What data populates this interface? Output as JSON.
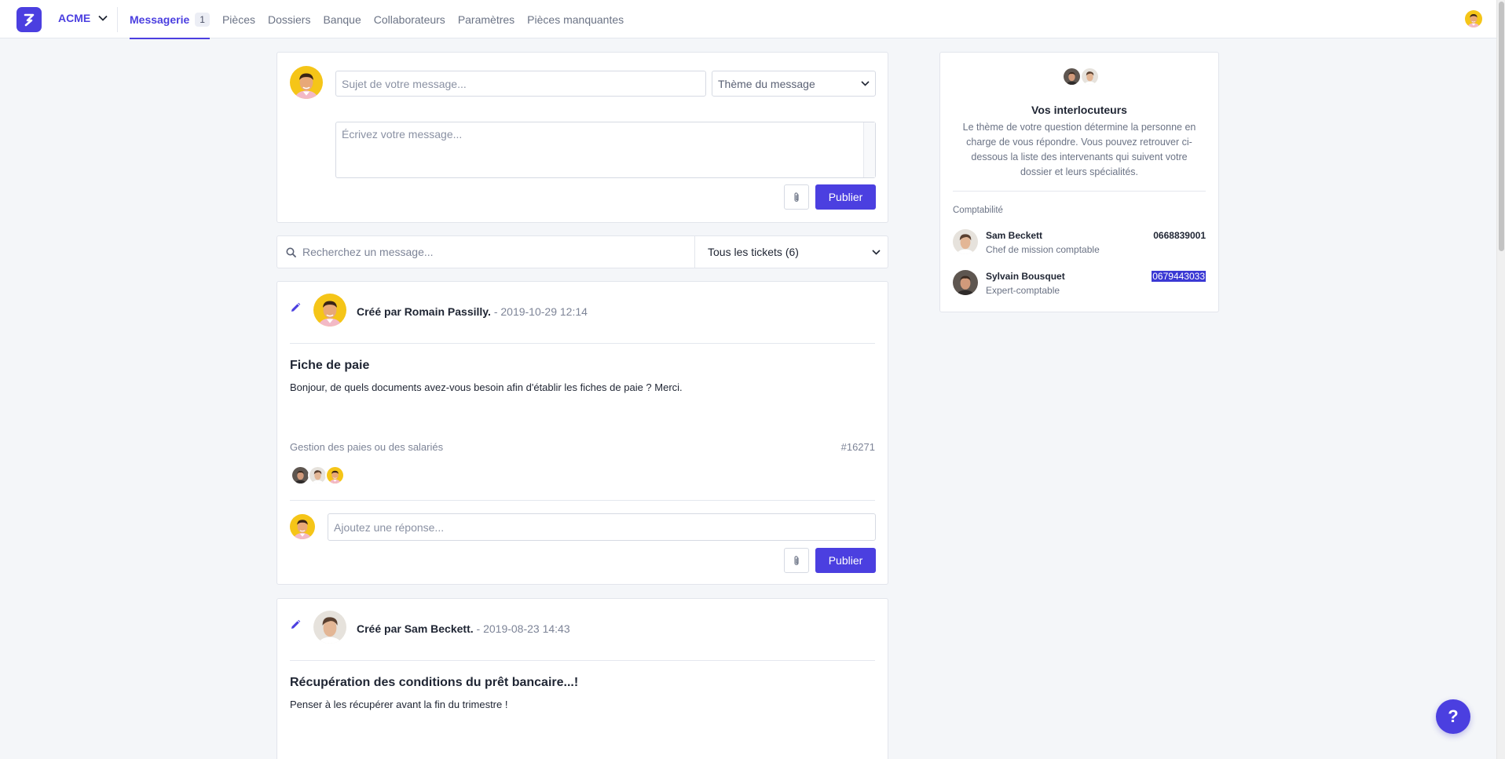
{
  "nav": {
    "company": "ACME",
    "items": [
      {
        "label": "Messagerie",
        "badge": "1"
      },
      {
        "label": "Pièces"
      },
      {
        "label": "Dossiers"
      },
      {
        "label": "Banque"
      },
      {
        "label": "Collaborateurs"
      },
      {
        "label": "Paramètres"
      },
      {
        "label": "Pièces manquantes"
      }
    ]
  },
  "compose": {
    "subject_placeholder": "Sujet de votre message...",
    "theme_label": "Thème du message",
    "body_placeholder": "Écrivez votre message...",
    "publish": "Publier"
  },
  "search": {
    "placeholder": "Recherchez un message...",
    "filter": "Tous les tickets (6)"
  },
  "posts": [
    {
      "author": "Créé par Romain Passilly.",
      "date": "- 2019-10-29 12:14",
      "title": "Fiche de paie",
      "body": "Bonjour, de quels documents avez-vous besoin afin d'établir les fiches de paie ? Merci.",
      "theme": "Gestion des paies ou des salariés",
      "id": "#16271",
      "reply_placeholder": "Ajoutez une réponse...",
      "publish": "Publier"
    },
    {
      "author": "Créé par Sam Beckett.",
      "date": "- 2019-08-23 14:43",
      "title": "Récupération des conditions du prêt bancaire...!",
      "body": "Penser à les récupérer avant la fin du trimestre !"
    }
  ],
  "side": {
    "title": "Vos interlocuteurs",
    "description": "Le thème de votre question détermine la personne en charge de vous répondre. Vous pouvez retrouver ci-dessous la liste des intervenants qui suivent votre dossier et leurs spécialités.",
    "category": "Comptabilité",
    "contacts": [
      {
        "name": "Sam Beckett",
        "role": "Chef de mission comptable",
        "phone": "0668839001"
      },
      {
        "name": "Sylvain Bousquet",
        "role": "Expert-comptable",
        "phone": "0679443033"
      }
    ]
  },
  "help": "?",
  "colors": {
    "accent": "#4b3fe0",
    "background": "#f4f6f9"
  },
  "icons": [
    "logo-icon",
    "chevron-down-icon",
    "paperclip-icon",
    "search-icon",
    "pencil-icon",
    "help-icon"
  ]
}
